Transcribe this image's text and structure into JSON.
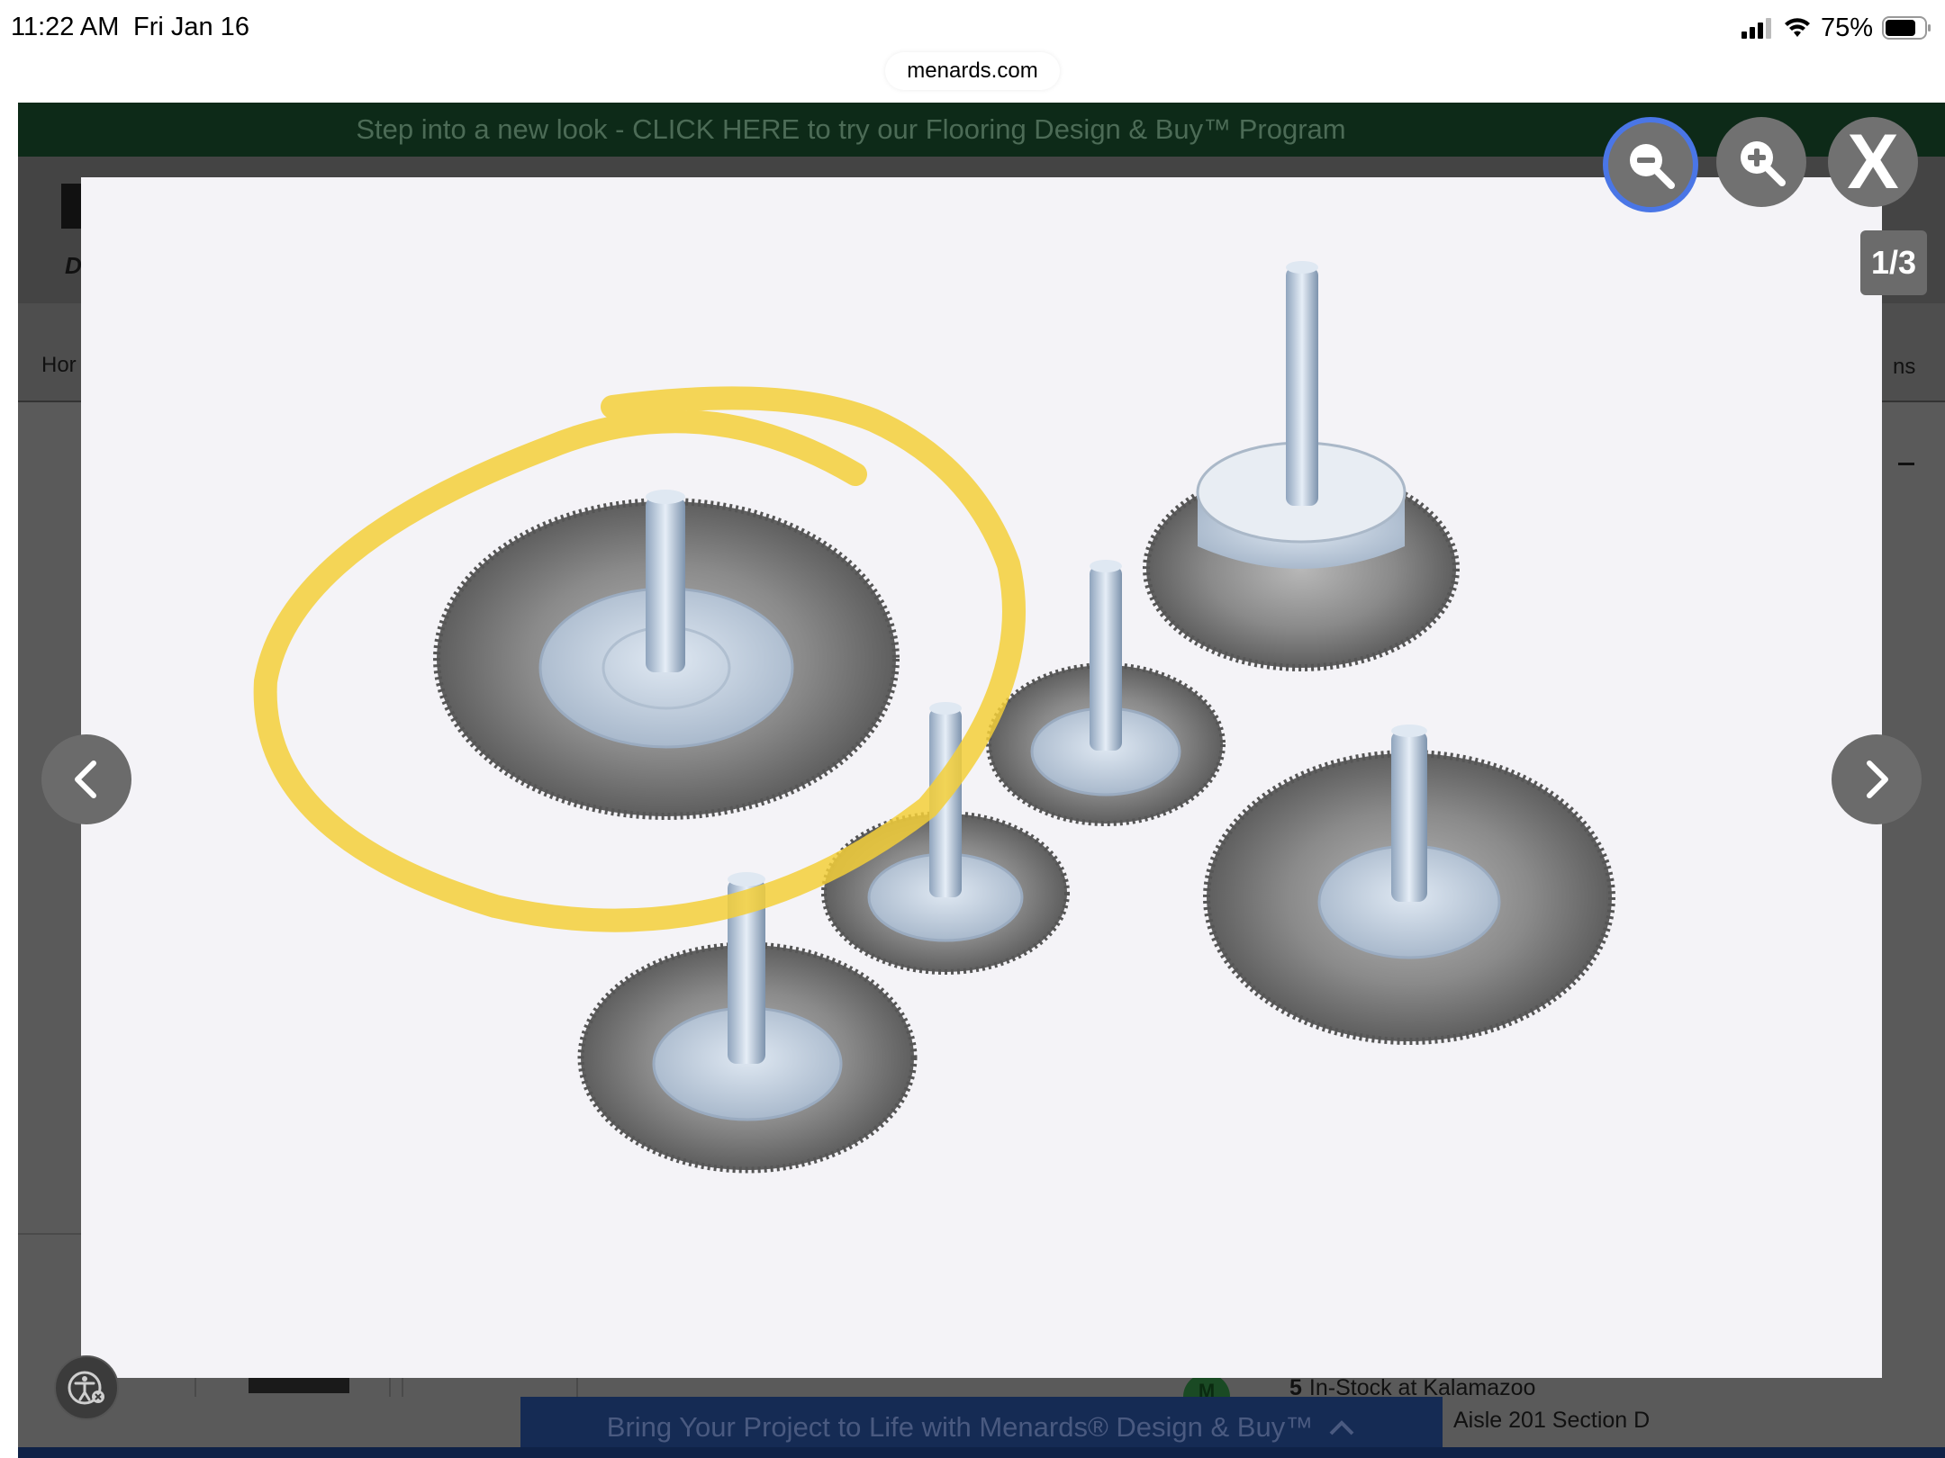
{
  "status_bar": {
    "time": "11:22 AM",
    "date": "Fri Jan 16",
    "battery": "75%",
    "url": "menards.com"
  },
  "site": {
    "promo_banner": "Step into a new look - CLICK HERE to try our Flooring Design & Buy™ Program",
    "logo_text": "D",
    "nav_left_fragment": "Hor",
    "nav_right_fragment": "ns",
    "stock_badge": "M",
    "stock_count": "5",
    "stock_text": "In-Stock at Kalamazoo",
    "aisle": "Aisle 201 Section D",
    "bottom_banner": "Bring Your Project to Life with Menards® Design & Buy™"
  },
  "lightbox": {
    "page_counter": "1/3",
    "close_label": "X",
    "accent_color": "#4a76e6",
    "annotation_color": "#f3cf3a"
  }
}
